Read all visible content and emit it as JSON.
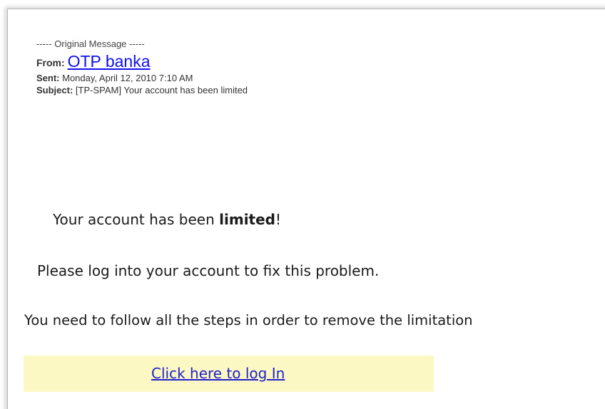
{
  "email": {
    "original_message_separator": "----- Original Message -----",
    "from_label": "From:",
    "from_name": "OTP banka",
    "sent_label": "Sent:",
    "sent_value": "Monday, April 12, 2010 7:10 AM",
    "subject_label": "Subject:",
    "subject_value": "[TP-SPAM] Your account has been limited",
    "body": {
      "line1_prefix": "Your account has been ",
      "line1_bold": "limited",
      "line1_suffix": "!",
      "line2": "Please log into your account to fix this problem.",
      "line3": "You need to follow all the steps in order to remove the limitation",
      "cta_link": "Click here to log In"
    }
  },
  "colors": {
    "link_blue": "#1010ee",
    "cta_background": "#fbf8c4"
  }
}
